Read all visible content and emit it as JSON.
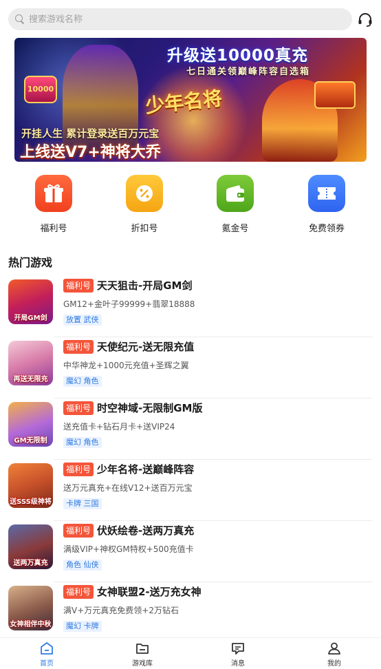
{
  "search": {
    "placeholder": "搜索游戏名称",
    "value": ""
  },
  "banner": {
    "headline": "升级送10000真充",
    "subline": "七日通关领巅峰阵容自选箱",
    "logo": "少年名将",
    "promo_line1": "开挂人生  累计登录送百万元宝",
    "promo_line2": "上线送V7+神将大乔",
    "coin_text": "10000",
    "colors": {
      "start": "#0e1a58",
      "end": "#f2a01f"
    }
  },
  "quick_entries": [
    {
      "label": "福利号",
      "icon": "gift-icon",
      "color_top": "#ff6a3d",
      "color_bottom": "#f0411f"
    },
    {
      "label": "折扣号",
      "icon": "discount-icon",
      "color_top": "#ffc93a",
      "color_bottom": "#f5a512"
    },
    {
      "label": "氪金号",
      "icon": "wallet-icon",
      "color_top": "#7ecb3a",
      "color_bottom": "#4ea61a"
    },
    {
      "label": "免费领券",
      "icon": "coupon-icon",
      "color_top": "#4e8cff",
      "color_bottom": "#2f64f0"
    }
  ],
  "hot_section": {
    "title": "热门游戏"
  },
  "games": [
    {
      "tag": "福利号",
      "title": "天天狙击-开局GM剑",
      "desc": "GM12+金叶子99999+翡翠18888",
      "cats": "放置 武侠",
      "cover_text": "开局GM剑",
      "cover_colors": [
        "#f25a2a",
        "#7a1a8a"
      ]
    },
    {
      "tag": "福利号",
      "title": "天使纪元-送无限充值",
      "desc": "中华神龙+1000元充值+圣辉之翼",
      "cats": "魔幻 角色",
      "cover_text": "再送无限充",
      "cover_colors": [
        "#f4c9d6",
        "#8a3a9a"
      ]
    },
    {
      "tag": "福利号",
      "title": "时空神域-无限制GM版",
      "desc": "送充值卡+钻石月卡+送VIP24",
      "cats": "魔幻 角色",
      "cover_text": "GM无限制",
      "cover_colors": [
        "#f3b04a",
        "#6a4ab8"
      ]
    },
    {
      "tag": "福利号",
      "title": "少年名将-送巅峰阵容",
      "desc": "送万元真充+在线V12+送百万元宝",
      "cats": "卡牌 三国",
      "cover_text": "送SSS级神将",
      "cover_colors": [
        "#f0823a",
        "#7a2a1a"
      ]
    },
    {
      "tag": "福利号",
      "title": "伏妖绘卷-送两万真充",
      "desc": "满级VIP+神权GM特权+500充值卡",
      "cats": "角色 仙侠",
      "cover_text": "送两万真充",
      "cover_colors": [
        "#5a6aa8",
        "#2a1a3a"
      ]
    },
    {
      "tag": "福利号",
      "title": "女神联盟2-送万充女神",
      "desc": "满V+万元真充免费领+2万钻石",
      "cats": "魔幻 卡牌",
      "cover_text": "女神相伴中秋",
      "cover_colors": [
        "#d8b08a",
        "#3a2a3a"
      ]
    }
  ],
  "tabbar": [
    {
      "label": "首页",
      "icon": "home-icon",
      "active": true
    },
    {
      "label": "游戏库",
      "icon": "folder-icon",
      "active": false
    },
    {
      "label": "消息",
      "icon": "message-icon",
      "active": false
    },
    {
      "label": "我的",
      "icon": "profile-icon",
      "active": false
    }
  ],
  "colors": {
    "accent": "#2f7be0",
    "tag": "#f4553a",
    "category_bg": "#eaf2ff"
  }
}
